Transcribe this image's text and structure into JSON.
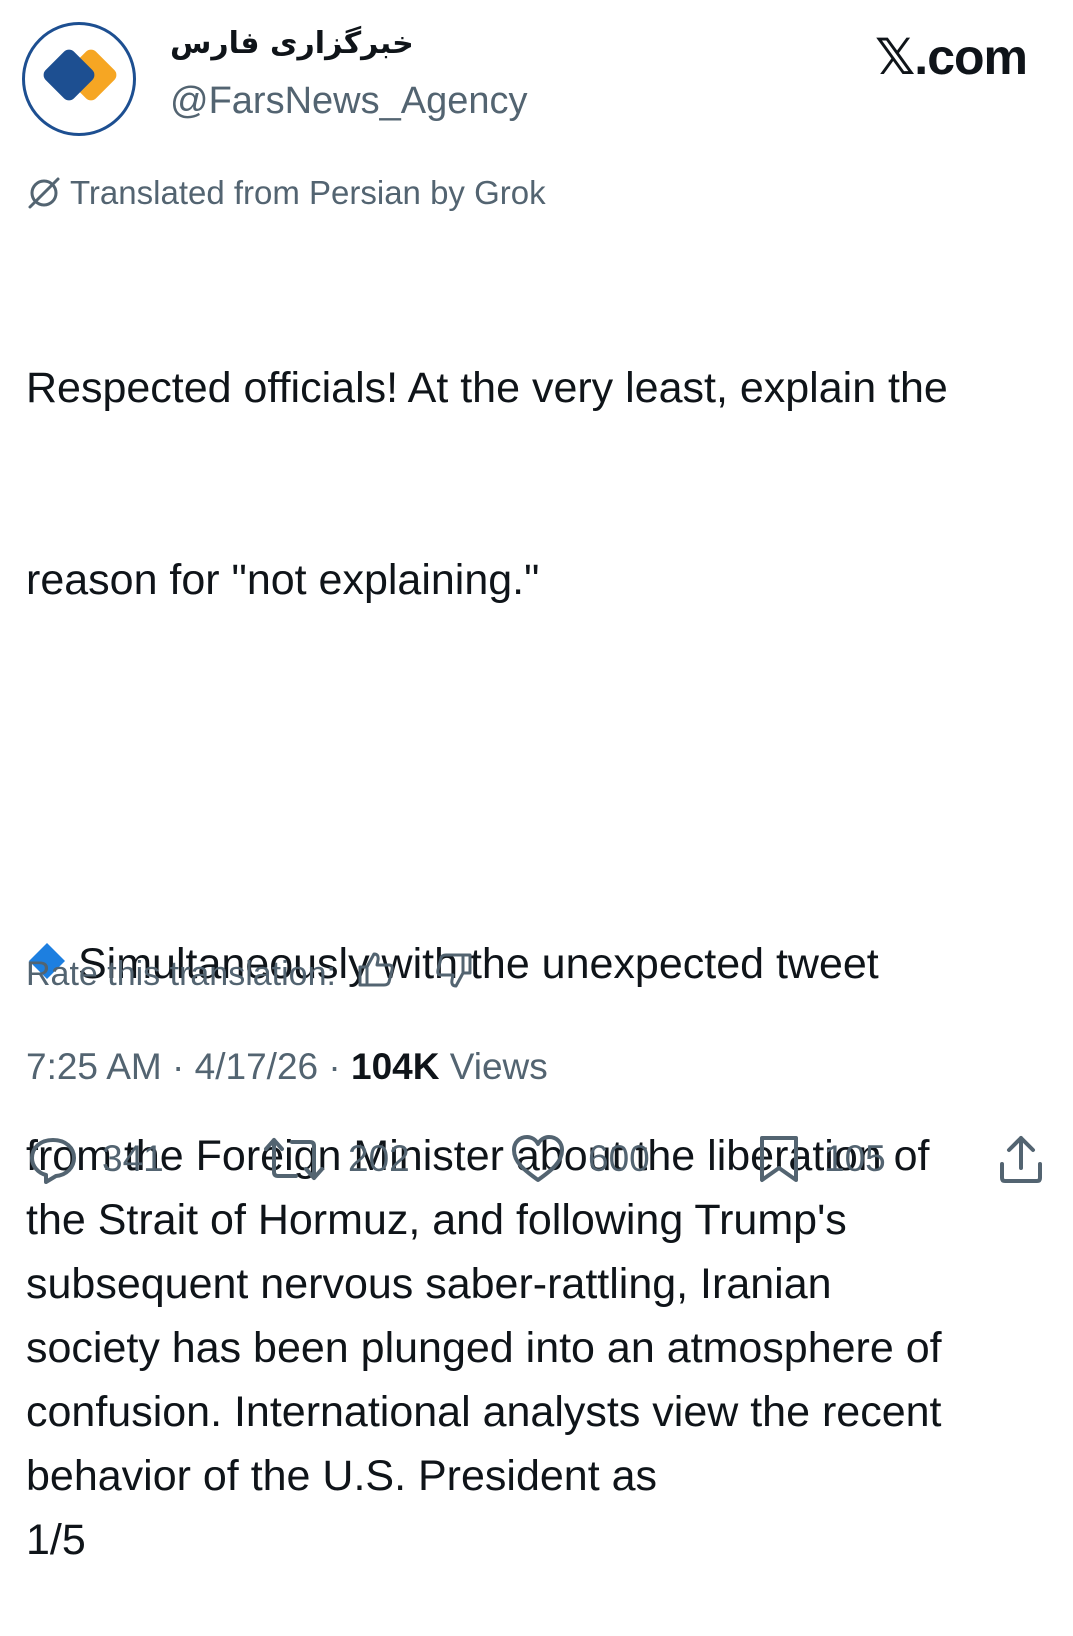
{
  "header": {
    "display_name": "خبرگزاری فارس",
    "handle": "@FarsNews_Agency",
    "brand": "𝕏.com"
  },
  "avatar": {
    "icon": "fars-news-logo",
    "colors": {
      "blue": "#1d4f91",
      "orange": "#f6a623"
    }
  },
  "translation": {
    "note": "Translated from Persian by Grok",
    "rate_label": "Rate this translation:"
  },
  "tweet": {
    "line1": "Respected officials! At the very least, explain the",
    "line2": "reason for \"not explaining.\"",
    "p2_first": "Simultaneously with the unexpected tweet",
    "p2_rest": "from the Foreign Minister about the liberation of\nthe Strait of Hormuz, and following Trump's\nsubsequent nervous saber-rattling, Iranian\nsociety has been plunged into an atmosphere of\nconfusion. International analysts view the recent\nbehavior of the U.S. President as\n1/5"
  },
  "meta": {
    "time": "7:25 AM",
    "sep": "·",
    "date": "4/17/26",
    "views_count": "104K",
    "views_label": "Views"
  },
  "actions": {
    "replies": "341",
    "reposts": "202",
    "likes": "600",
    "bookmarks": "105"
  }
}
